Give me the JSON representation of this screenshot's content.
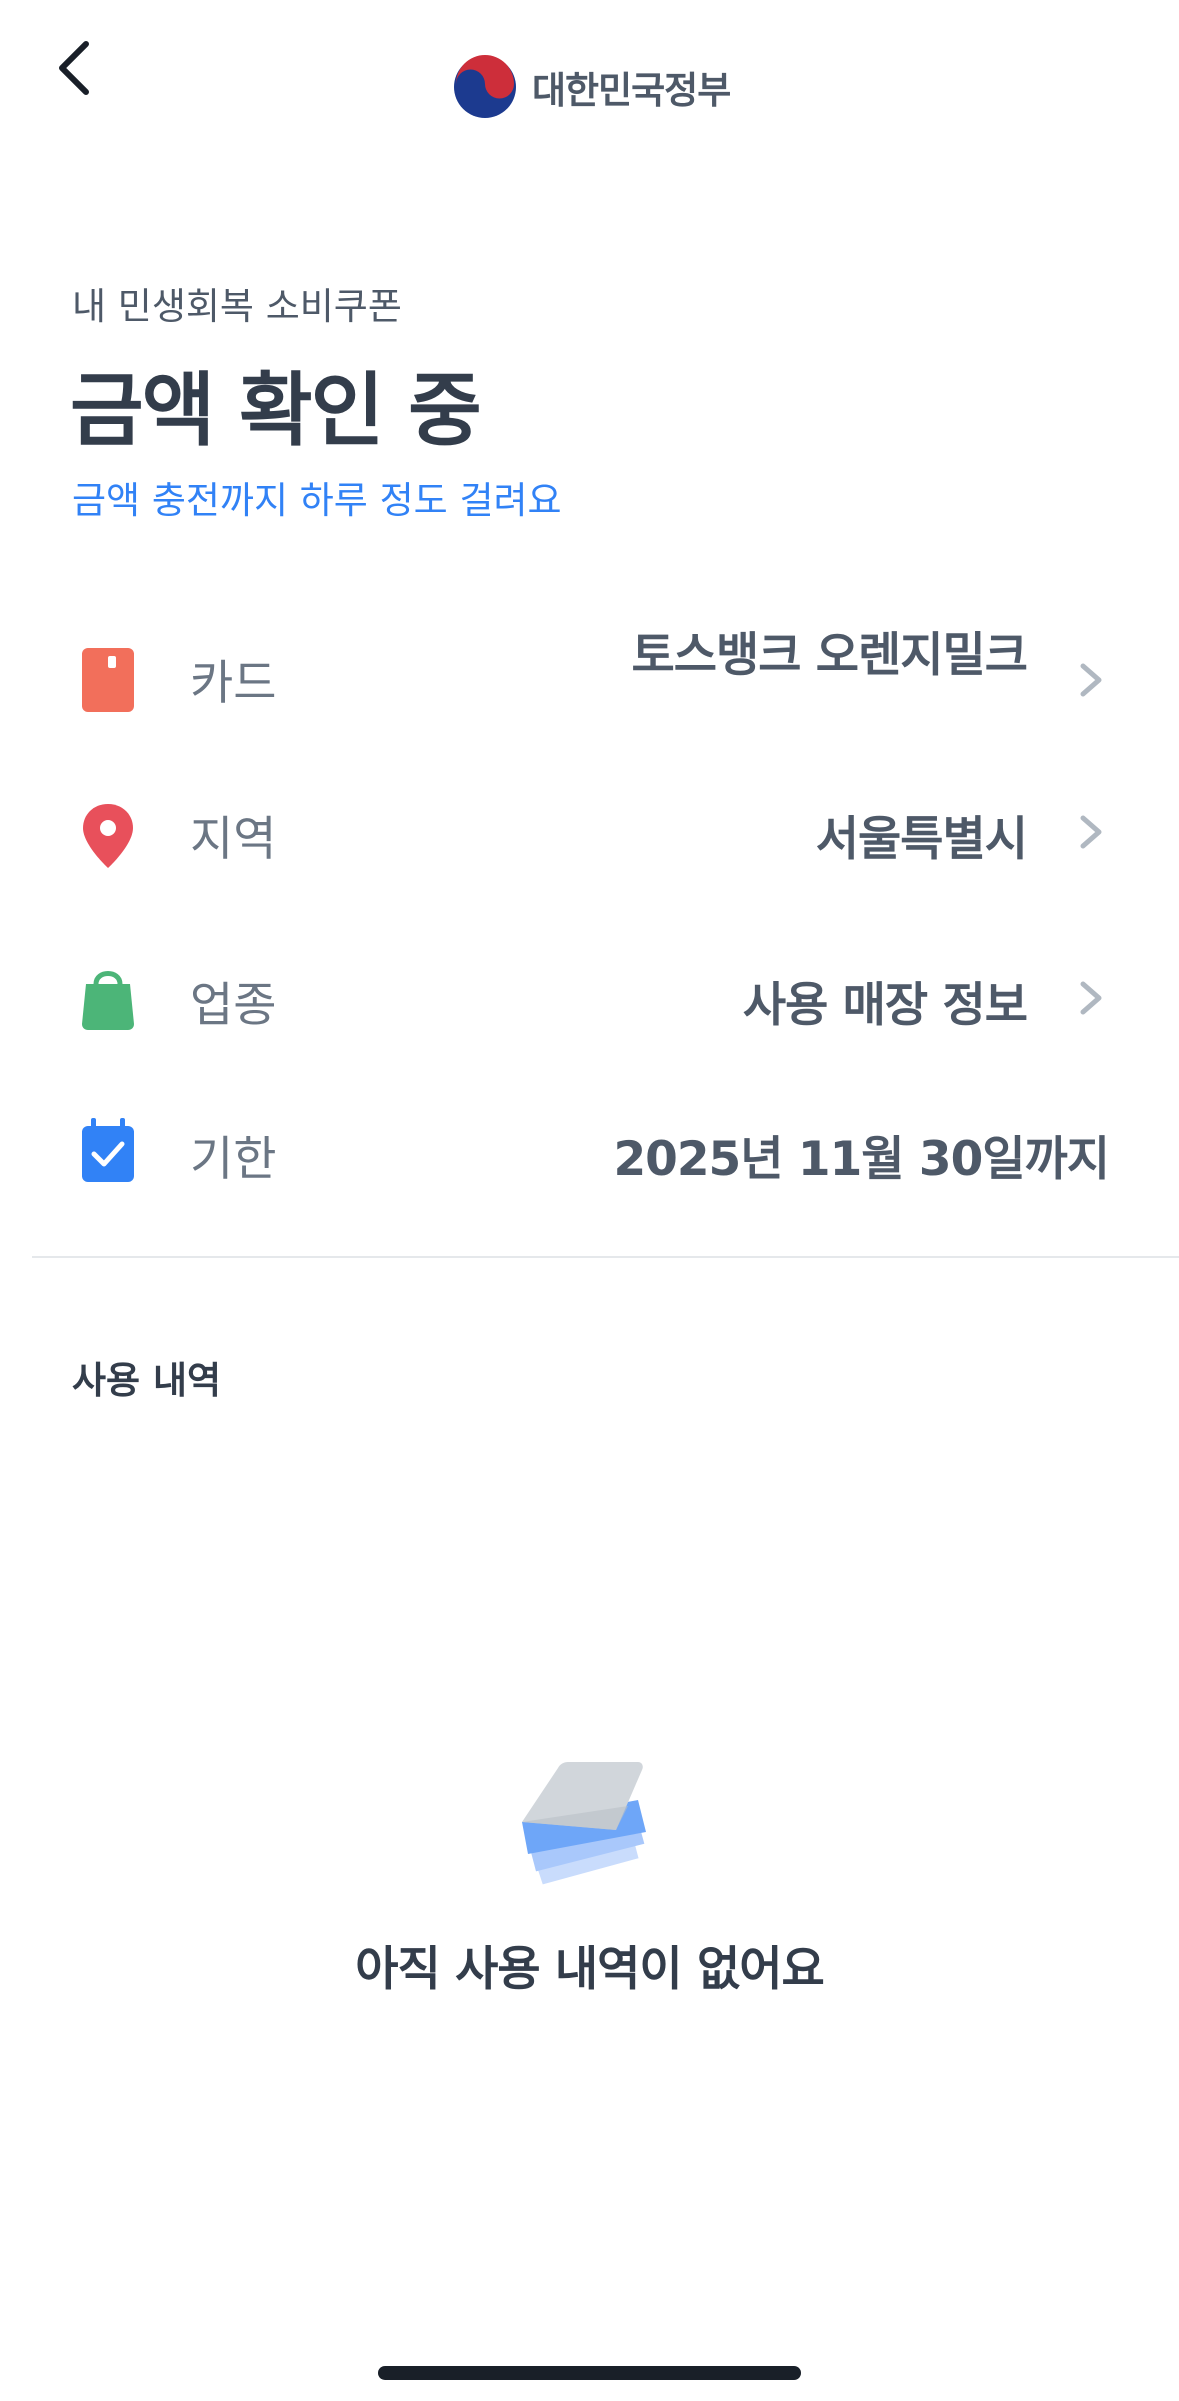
{
  "header": {
    "logo_text": "대한민국정부"
  },
  "coupon": {
    "subtitle": "내 민생회복 소비쿠폰",
    "title": "금액 확인 중",
    "description": "금액 충전까지 하루 정도 걸려요"
  },
  "info_rows": [
    {
      "label": "카드",
      "value": "토스뱅크 오렌지밀크",
      "icon": "card-icon",
      "color": "#f26f5b"
    },
    {
      "label": "지역",
      "value": "서울특별시",
      "icon": "location-pin-icon",
      "color": "#e8505b"
    },
    {
      "label": "업종",
      "value": "사용 매장 정보",
      "icon": "shopping-bag-icon",
      "color": "#4cb578"
    },
    {
      "label": "기한",
      "value": "2025년 11월 30일까지",
      "icon": "calendar-check-icon",
      "color": "#3182f6"
    }
  ],
  "history": {
    "title": "사용 내역",
    "empty_text": "아직 사용 내역이 없어요"
  }
}
